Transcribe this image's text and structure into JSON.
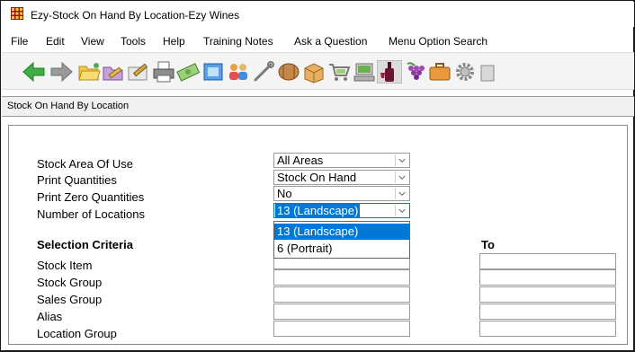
{
  "window": {
    "title": "Ezy-Stock On Hand By Location-Ezy Wines",
    "icon": "app-grid-icon"
  },
  "menu": [
    "File",
    "Edit",
    "View",
    "Tools",
    "Help",
    "Training Notes",
    "Ask a Question",
    "Menu Option Search"
  ],
  "toolbar": {
    "icons": [
      "back-arrow-icon",
      "forward-arrow-icon",
      "folder-open-icon",
      "folder-pencil-icon",
      "edit-pencil-icon",
      "printer-icon",
      "money-icon",
      "document-icon",
      "users-icon",
      "wrench-icon",
      "barrel-icon",
      "box-icon",
      "cart-icon",
      "computer-icon",
      "wine-bottle-icon",
      "grapes-icon",
      "briefcase-icon",
      "gear-icon",
      "trash-icon"
    ]
  },
  "panel": {
    "title": "Stock On Hand By Location"
  },
  "form": {
    "stock_area_label": "Stock Area Of Use",
    "stock_area_value": "All Areas",
    "print_quantities_label": "Print Quantities",
    "print_quantities_value": "Stock On Hand",
    "print_zero_label": "Print Zero Quantities",
    "print_zero_value": "No",
    "num_locations_label": "Number of Locations",
    "num_locations_value": "13 (Landscape)",
    "num_locations_options": [
      "13 (Landscape)",
      "6 (Portrait)"
    ]
  },
  "selection": {
    "heading": "Selection Criteria",
    "to_heading": "To",
    "rows": [
      "Stock Item",
      "Stock Group",
      "Sales Group",
      "Alias",
      "Location Group"
    ]
  }
}
